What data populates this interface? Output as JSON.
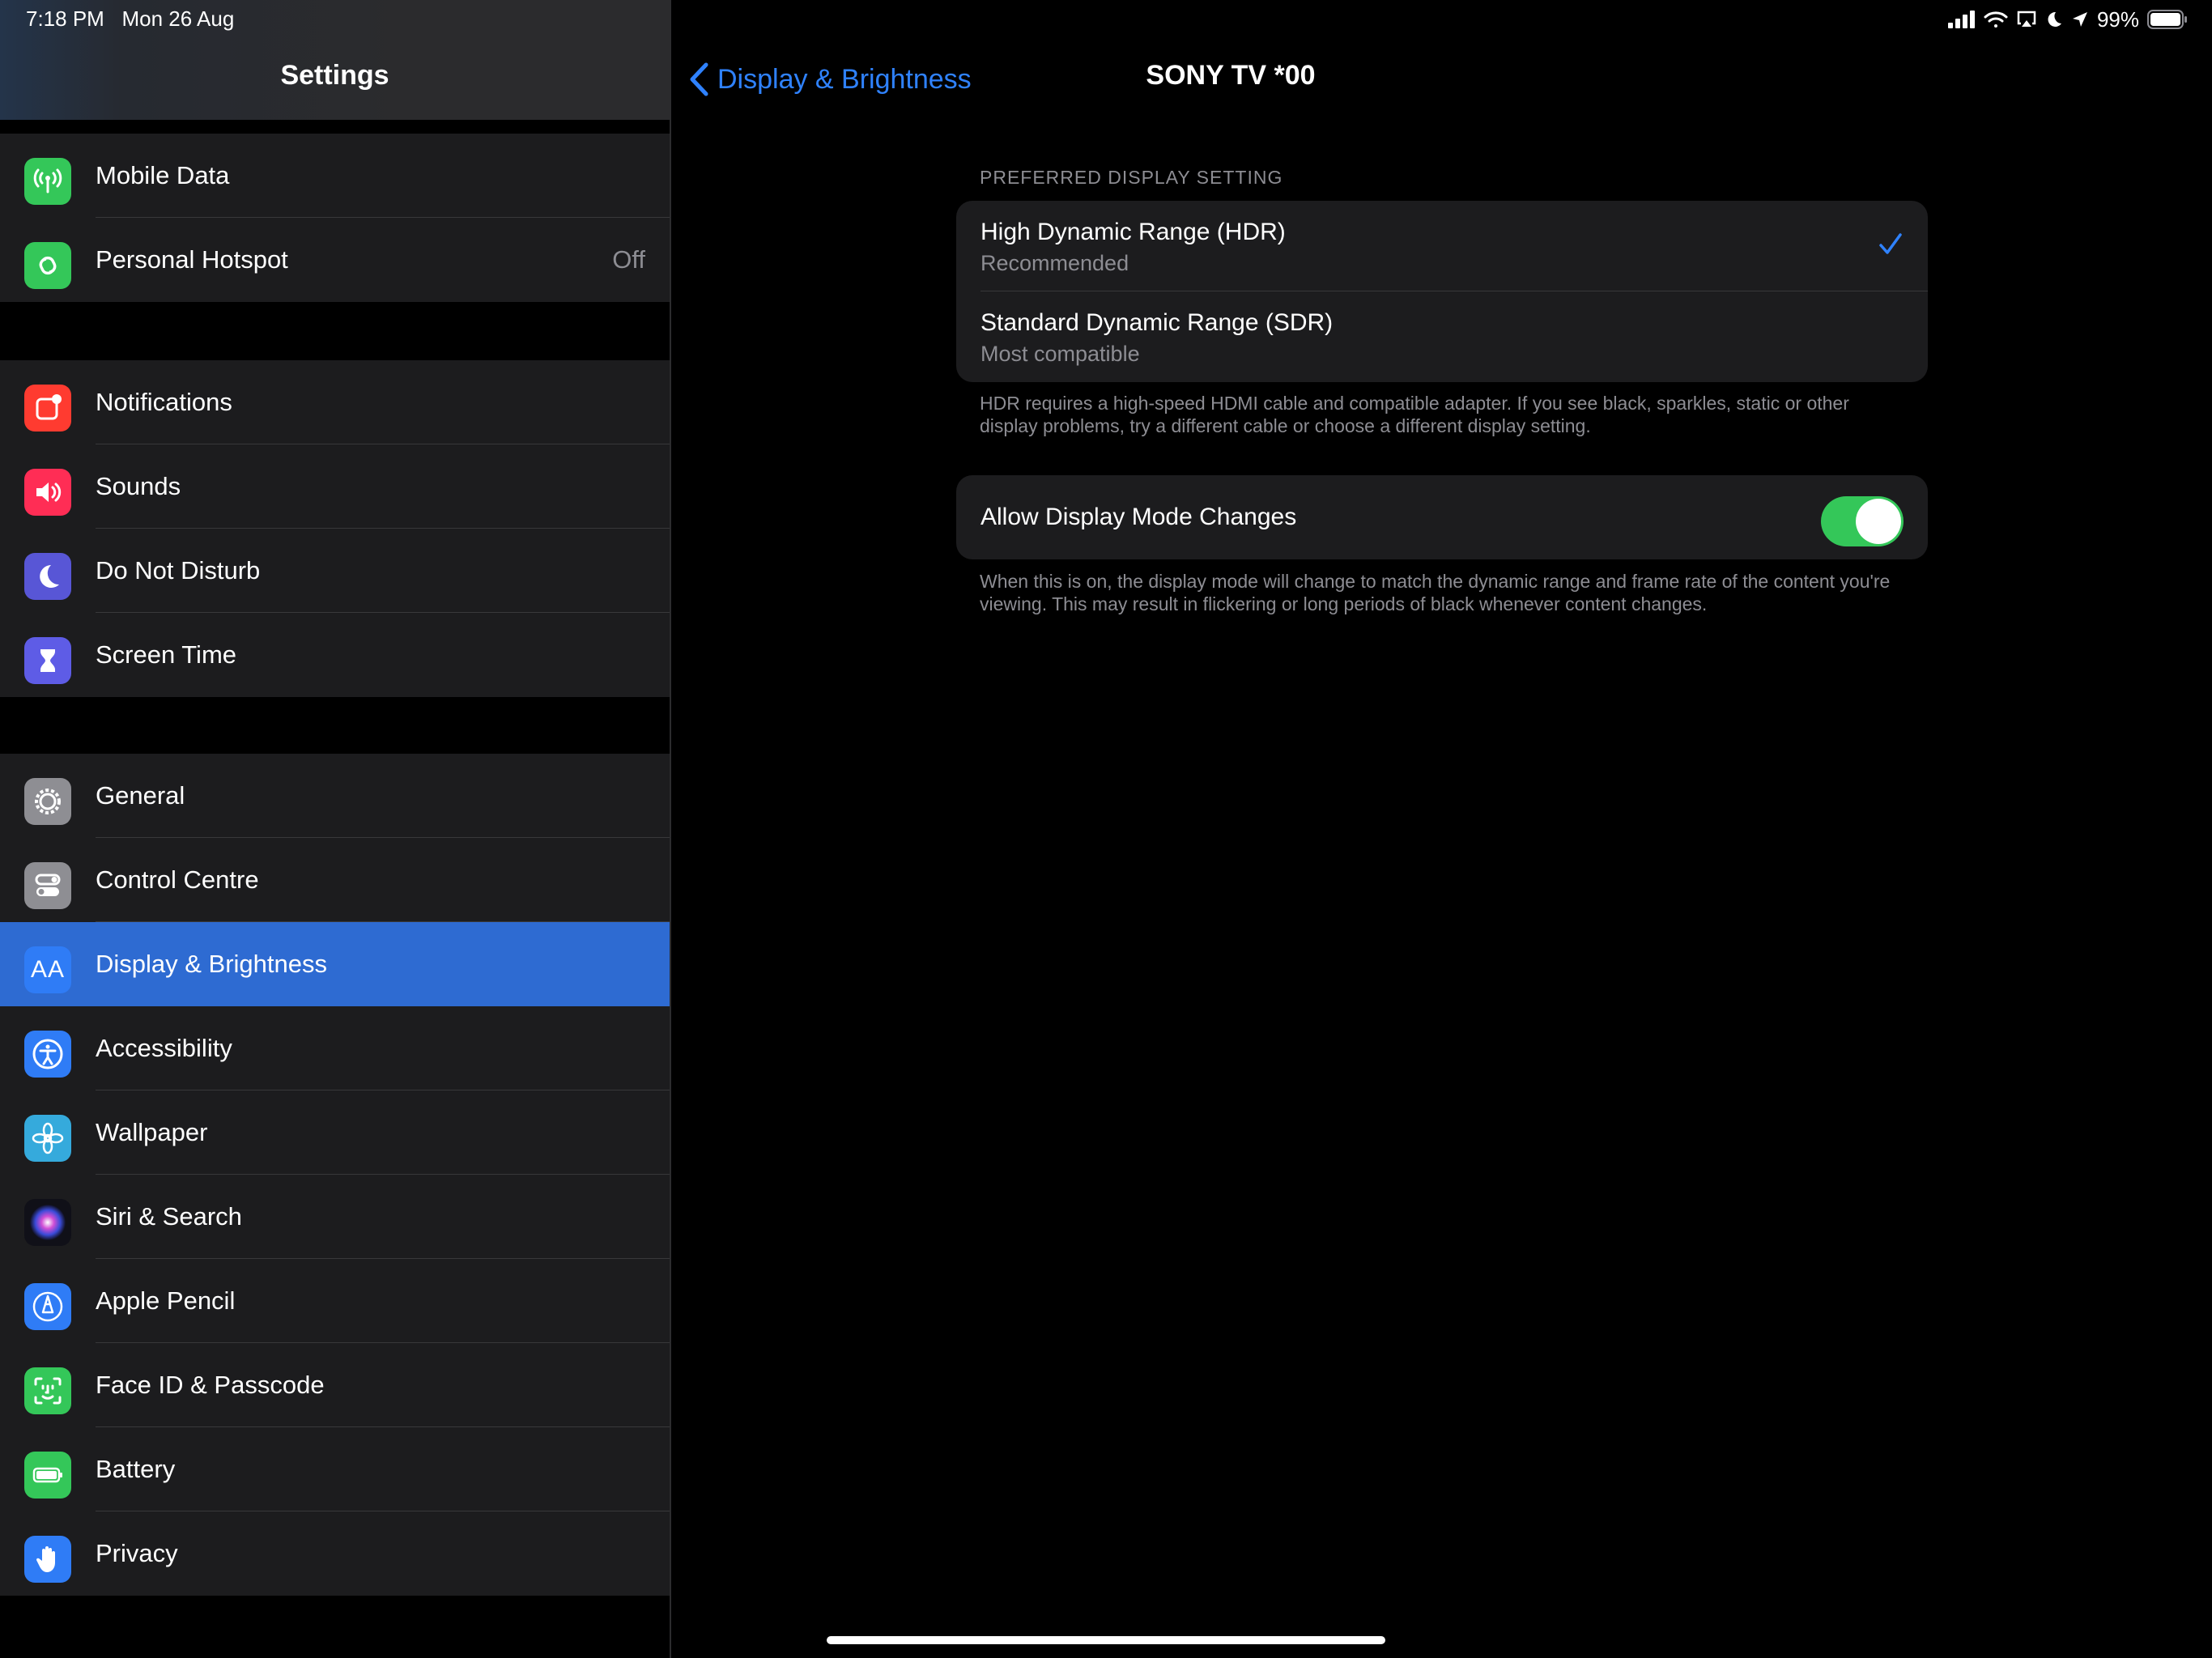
{
  "status_bar": {
    "time": "7:18 PM",
    "date": "Mon 26 Aug",
    "battery": "99%",
    "icons": [
      "signal-icon",
      "wifi-icon",
      "airplay-icon",
      "moon-icon",
      "location-icon",
      "battery-icon"
    ]
  },
  "sidebar": {
    "title": "Settings",
    "groups": [
      {
        "items": [
          {
            "label": "Mobile Data",
            "icon": "antenna-icon",
            "color": "#34c759"
          },
          {
            "label": "Personal Hotspot",
            "value": "Off",
            "icon": "hotspot-icon",
            "color": "#34c759"
          }
        ]
      },
      {
        "items": [
          {
            "label": "Notifications",
            "icon": "notifications-icon",
            "color": "#ff3b30"
          },
          {
            "label": "Sounds",
            "icon": "speaker-icon",
            "color": "#ff2d55"
          },
          {
            "label": "Do Not Disturb",
            "icon": "moon-icon",
            "color": "#5856d6"
          },
          {
            "label": "Screen Time",
            "icon": "hourglass-icon",
            "color": "#5e5ce6"
          }
        ]
      },
      {
        "items": [
          {
            "label": "General",
            "icon": "gear-icon",
            "color": "#8e8e93"
          },
          {
            "label": "Control Centre",
            "icon": "switches-icon",
            "color": "#8e8e93"
          },
          {
            "label": "Display & Brightness",
            "icon": "text-size-icon",
            "color": "#2f7cf6",
            "selected": true
          },
          {
            "label": "Accessibility",
            "icon": "accessibility-icon",
            "color": "#2f7cf6"
          },
          {
            "label": "Wallpaper",
            "icon": "flower-icon",
            "color": "#35aadc"
          },
          {
            "label": "Siri & Search",
            "icon": "siri-icon",
            "color": "#1c1c1e"
          },
          {
            "label": "Apple Pencil",
            "icon": "pencil-icon",
            "color": "#2f7cf6"
          },
          {
            "label": "Face ID & Passcode",
            "icon": "face-id-icon",
            "color": "#34c759"
          },
          {
            "label": "Battery",
            "icon": "battery-icon",
            "color": "#34c759"
          },
          {
            "label": "Privacy",
            "icon": "hand-icon",
            "color": "#2f7cf6"
          }
        ]
      }
    ]
  },
  "detail": {
    "back_label": "Display & Brightness",
    "title": "SONY TV  *00",
    "section_header": "PREFERRED DISPLAY SETTING",
    "options": [
      {
        "title": "High Dynamic Range (HDR)",
        "subtitle": "Recommended",
        "checked": true
      },
      {
        "title": "Standard Dynamic Range (SDR)",
        "subtitle": "Most compatible",
        "checked": false
      }
    ],
    "options_footer": "HDR requires a high-speed HDMI cable and compatible adapter. If you see black, sparkles, static or other display problems, try a different cable or choose a different display setting.",
    "toggle": {
      "label": "Allow Display Mode Changes",
      "on": true,
      "color": "#34c759"
    },
    "toggle_footer": "When this is on, the display mode will change to match the dynamic range and frame rate of the content you're viewing. This may result in flickering or long periods of black whenever content changes."
  },
  "colors": {
    "accent": "#2f82ff",
    "selected_row": "#2e6bd2",
    "cell_background": "#1c1c1e",
    "secondary_text": "#8d8d93"
  }
}
